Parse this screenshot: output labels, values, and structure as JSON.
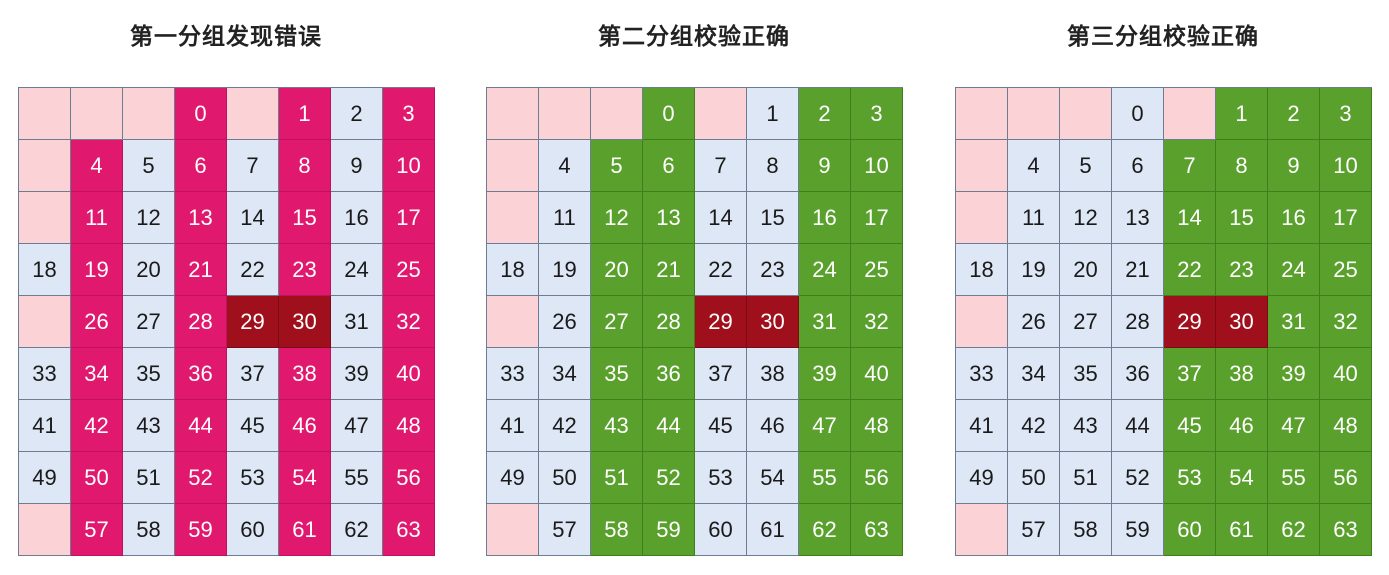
{
  "panels": [
    {
      "title": "第一分组发现错误",
      "group_cols": [
        1,
        3,
        5,
        7
      ],
      "group_style": "group-red"
    },
    {
      "title": "第二分组校验正确",
      "group_cols": [
        2,
        3,
        6,
        7
      ],
      "group_style": "group-green"
    },
    {
      "title": "第三分组校验正确",
      "group_cols": [
        4,
        5,
        6,
        7
      ],
      "group_style": "group-green"
    }
  ],
  "grid": {
    "rows": [
      [
        "",
        "",
        "",
        "0",
        "",
        "1",
        "2",
        "3"
      ],
      [
        "",
        "4",
        "5",
        "6",
        "7",
        "8",
        "9",
        "10"
      ],
      [
        "",
        "11",
        "12",
        "13",
        "14",
        "15",
        "16",
        "17"
      ],
      [
        "18",
        "19",
        "20",
        "21",
        "22",
        "23",
        "24",
        "25"
      ],
      [
        "",
        "26",
        "27",
        "28",
        "29",
        "30",
        "31",
        "32"
      ],
      [
        "33",
        "34",
        "35",
        "36",
        "37",
        "38",
        "39",
        "40"
      ],
      [
        "41",
        "42",
        "43",
        "44",
        "45",
        "46",
        "47",
        "48"
      ],
      [
        "49",
        "50",
        "51",
        "52",
        "53",
        "54",
        "55",
        "56"
      ],
      [
        "",
        "57",
        "58",
        "59",
        "60",
        "61",
        "62",
        "63"
      ]
    ],
    "error_values": [
      "29",
      "30"
    ]
  },
  "colors": {
    "empty": "#fbd3d6",
    "normal": "#dde7f5",
    "group_red": "#e0186e",
    "group_green": "#5aa02c",
    "error": "#a0101c"
  }
}
